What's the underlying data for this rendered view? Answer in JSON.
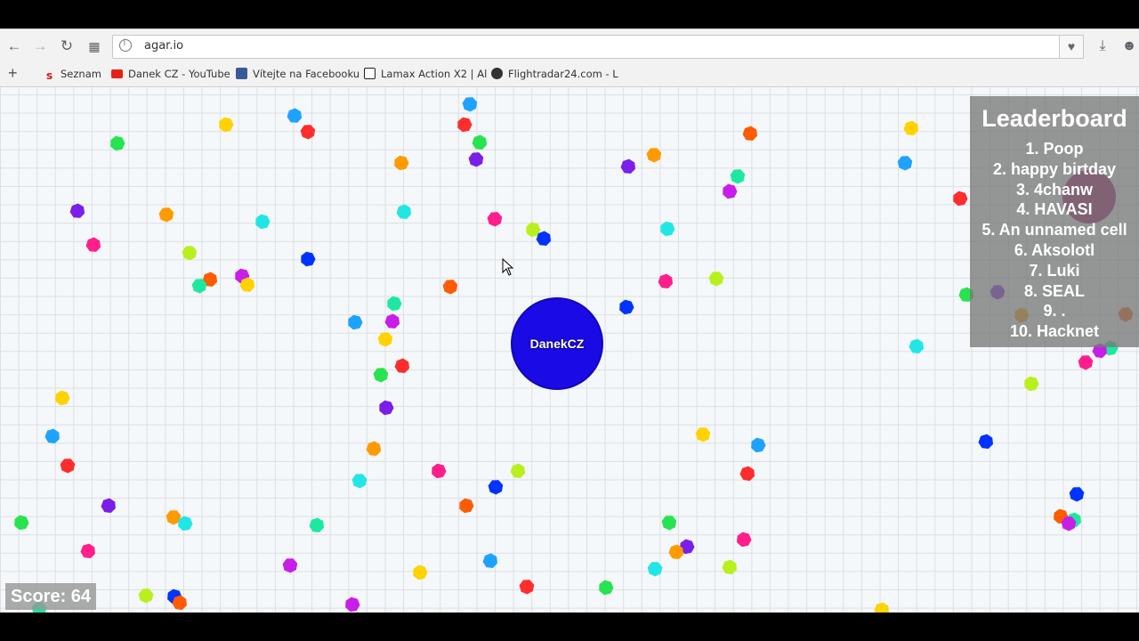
{
  "browser": {
    "url": "agar.io",
    "bookmarks": [
      {
        "label": "Seznam",
        "icon": "seznam-icon",
        "color": "#d7141a"
      },
      {
        "label": "Danek CZ - YouTube",
        "icon": "youtube-icon",
        "color": "#e62117"
      },
      {
        "label": "Vítejte na Facebooku",
        "icon": "facebook-icon",
        "color": "#3b5998"
      },
      {
        "label": "Lamax Action X2 | Al",
        "icon": "lamax-icon",
        "color": "#222222"
      },
      {
        "label": "Flightradar24.com - L",
        "icon": "flightradar-icon",
        "color": "#333333"
      }
    ]
  },
  "game": {
    "player": {
      "name": "DanekCZ",
      "color": "#1a0ae6"
    },
    "score_text": "Score: 64",
    "leaderboard": {
      "title": "Leaderboard",
      "entries": [
        "1. Poop",
        "2. happy birtday",
        "3. 4chanw",
        "4. HAVASI",
        "5. An unnamed cell",
        "6. Aksolotl",
        "7. Luki",
        "8. SEAL",
        "9. .",
        "10. Hacknet"
      ]
    },
    "pellet_colors": [
      "#ff2d2d",
      "#ff5b00",
      "#ff9a00",
      "#ffd200",
      "#b8f01e",
      "#26e34f",
      "#1ee8a0",
      "#22e6e6",
      "#1ea2ff",
      "#0033ff",
      "#7a1ee8",
      "#c81ee8",
      "#ff1e8c"
    ]
  }
}
